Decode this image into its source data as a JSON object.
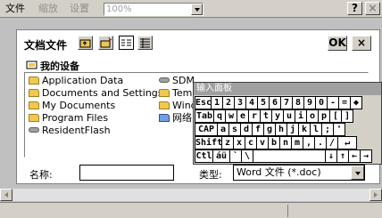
{
  "menubar": {
    "file": "文件",
    "zoom": "缩放",
    "settings": "设置",
    "zoom_value": "100%",
    "help_btn": "?",
    "close_btn": "×"
  },
  "dialog": {
    "title": "文档文件",
    "ok_btn": "OK",
    "close_btn": "×",
    "location": "我的设备",
    "files": [
      {
        "label": "Application Data",
        "icon": "folder-icon"
      },
      {
        "label": "Documents and Settings",
        "icon": "folder-icon"
      },
      {
        "label": "My Documents",
        "icon": "folder-icon"
      },
      {
        "label": "Program Files",
        "icon": "folder-icon"
      },
      {
        "label": "ResidentFlash",
        "icon": "drive-icon"
      },
      {
        "label": "SDMMC",
        "icon": "drive-icon"
      },
      {
        "label": "Temp",
        "icon": "folder-icon"
      },
      {
        "label": "Windows",
        "icon": "folder-icon"
      },
      {
        "label": "网络",
        "icon": "network-icon"
      }
    ],
    "name_label": "名称:",
    "name_value": "",
    "type_label": "类型:",
    "type_value": "Word 文件 (*.doc)"
  },
  "keyboard": {
    "title": "输入面板",
    "rows": [
      [
        "Esc",
        "1",
        "2",
        "3",
        "4",
        "5",
        "6",
        "7",
        "8",
        "9",
        "0",
        "-",
        "=",
        "◆"
      ],
      [
        "Tab",
        "q",
        "w",
        "e",
        "r",
        "t",
        "y",
        "u",
        "i",
        "o",
        "p",
        "[",
        "]"
      ],
      [
        "CAP",
        "a",
        "s",
        "d",
        "f",
        "g",
        "h",
        "j",
        "k",
        "l",
        ";",
        "'"
      ],
      [
        "Shift",
        "z",
        "x",
        "c",
        "v",
        "b",
        "n",
        "m",
        ",",
        ".",
        "/",
        "↵"
      ],
      [
        "Ctl",
        "áü",
        "`",
        "\\",
        "",
        "",
        "",
        "",
        "",
        "↓",
        "↑",
        "←",
        "→"
      ]
    ]
  }
}
